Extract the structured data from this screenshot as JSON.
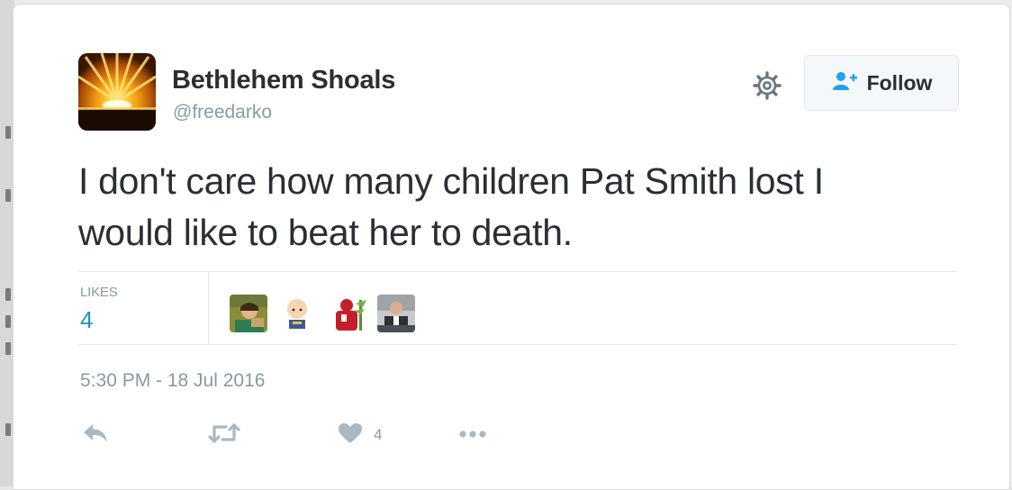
{
  "user": {
    "display_name": "Bethlehem Shoals",
    "handle": "@freedarko"
  },
  "follow_button": {
    "label": "Follow"
  },
  "tweet": {
    "text_line1": "I don't care how many children Pat Smith lost I",
    "text_line2": "would like to beat her to death."
  },
  "stats": {
    "likes_label": "LIKES",
    "likes_count": "4"
  },
  "likers": [
    {
      "icon": "liker-avatar"
    },
    {
      "icon": "liker-avatar"
    },
    {
      "icon": "liker-avatar"
    },
    {
      "icon": "liker-avatar"
    }
  ],
  "timestamp": "5:30 PM - 18 Jul 2016",
  "actions": {
    "reply_icon": "reply-icon",
    "retweet_icon": "retweet-icon",
    "like_icon": "heart-icon",
    "like_count": "4",
    "more_icon": "more-icon"
  },
  "colors": {
    "text": "#292f33",
    "muted": "#8899a6",
    "likes_accent": "#1b95b9",
    "follow_icon": "#1da1f2"
  }
}
